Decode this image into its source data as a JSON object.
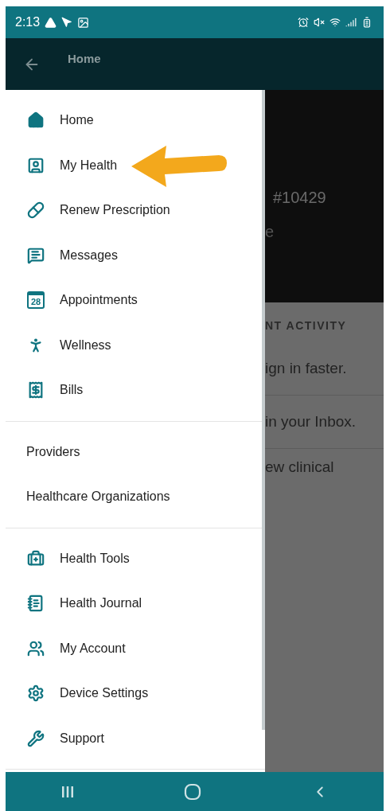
{
  "status_bar": {
    "time": "2:13"
  },
  "app_bar": {
    "title": "Home"
  },
  "background": {
    "header_texts": [
      "#10429",
      "e"
    ],
    "section_title": "NT ACTIVITY",
    "activity": [
      "ign in faster.",
      "in your Inbox.",
      "ew clinical"
    ]
  },
  "drawer": {
    "sections": [
      {
        "kind": "icon-list",
        "items": [
          {
            "label": "Home"
          },
          {
            "label": "My Health"
          },
          {
            "label": "Renew Prescription"
          },
          {
            "label": "Messages"
          },
          {
            "label": "Appointments",
            "icon_text": "28"
          },
          {
            "label": "Wellness"
          },
          {
            "label": "Bills"
          }
        ]
      },
      {
        "kind": "text-list",
        "items": [
          {
            "label": "Providers"
          },
          {
            "label": "Healthcare Organizations"
          }
        ]
      },
      {
        "kind": "icon-list",
        "items": [
          {
            "label": "Health Tools"
          },
          {
            "label": "Health Journal"
          },
          {
            "label": "My Account"
          },
          {
            "label": "Device Settings"
          },
          {
            "label": "Support"
          }
        ]
      }
    ]
  }
}
